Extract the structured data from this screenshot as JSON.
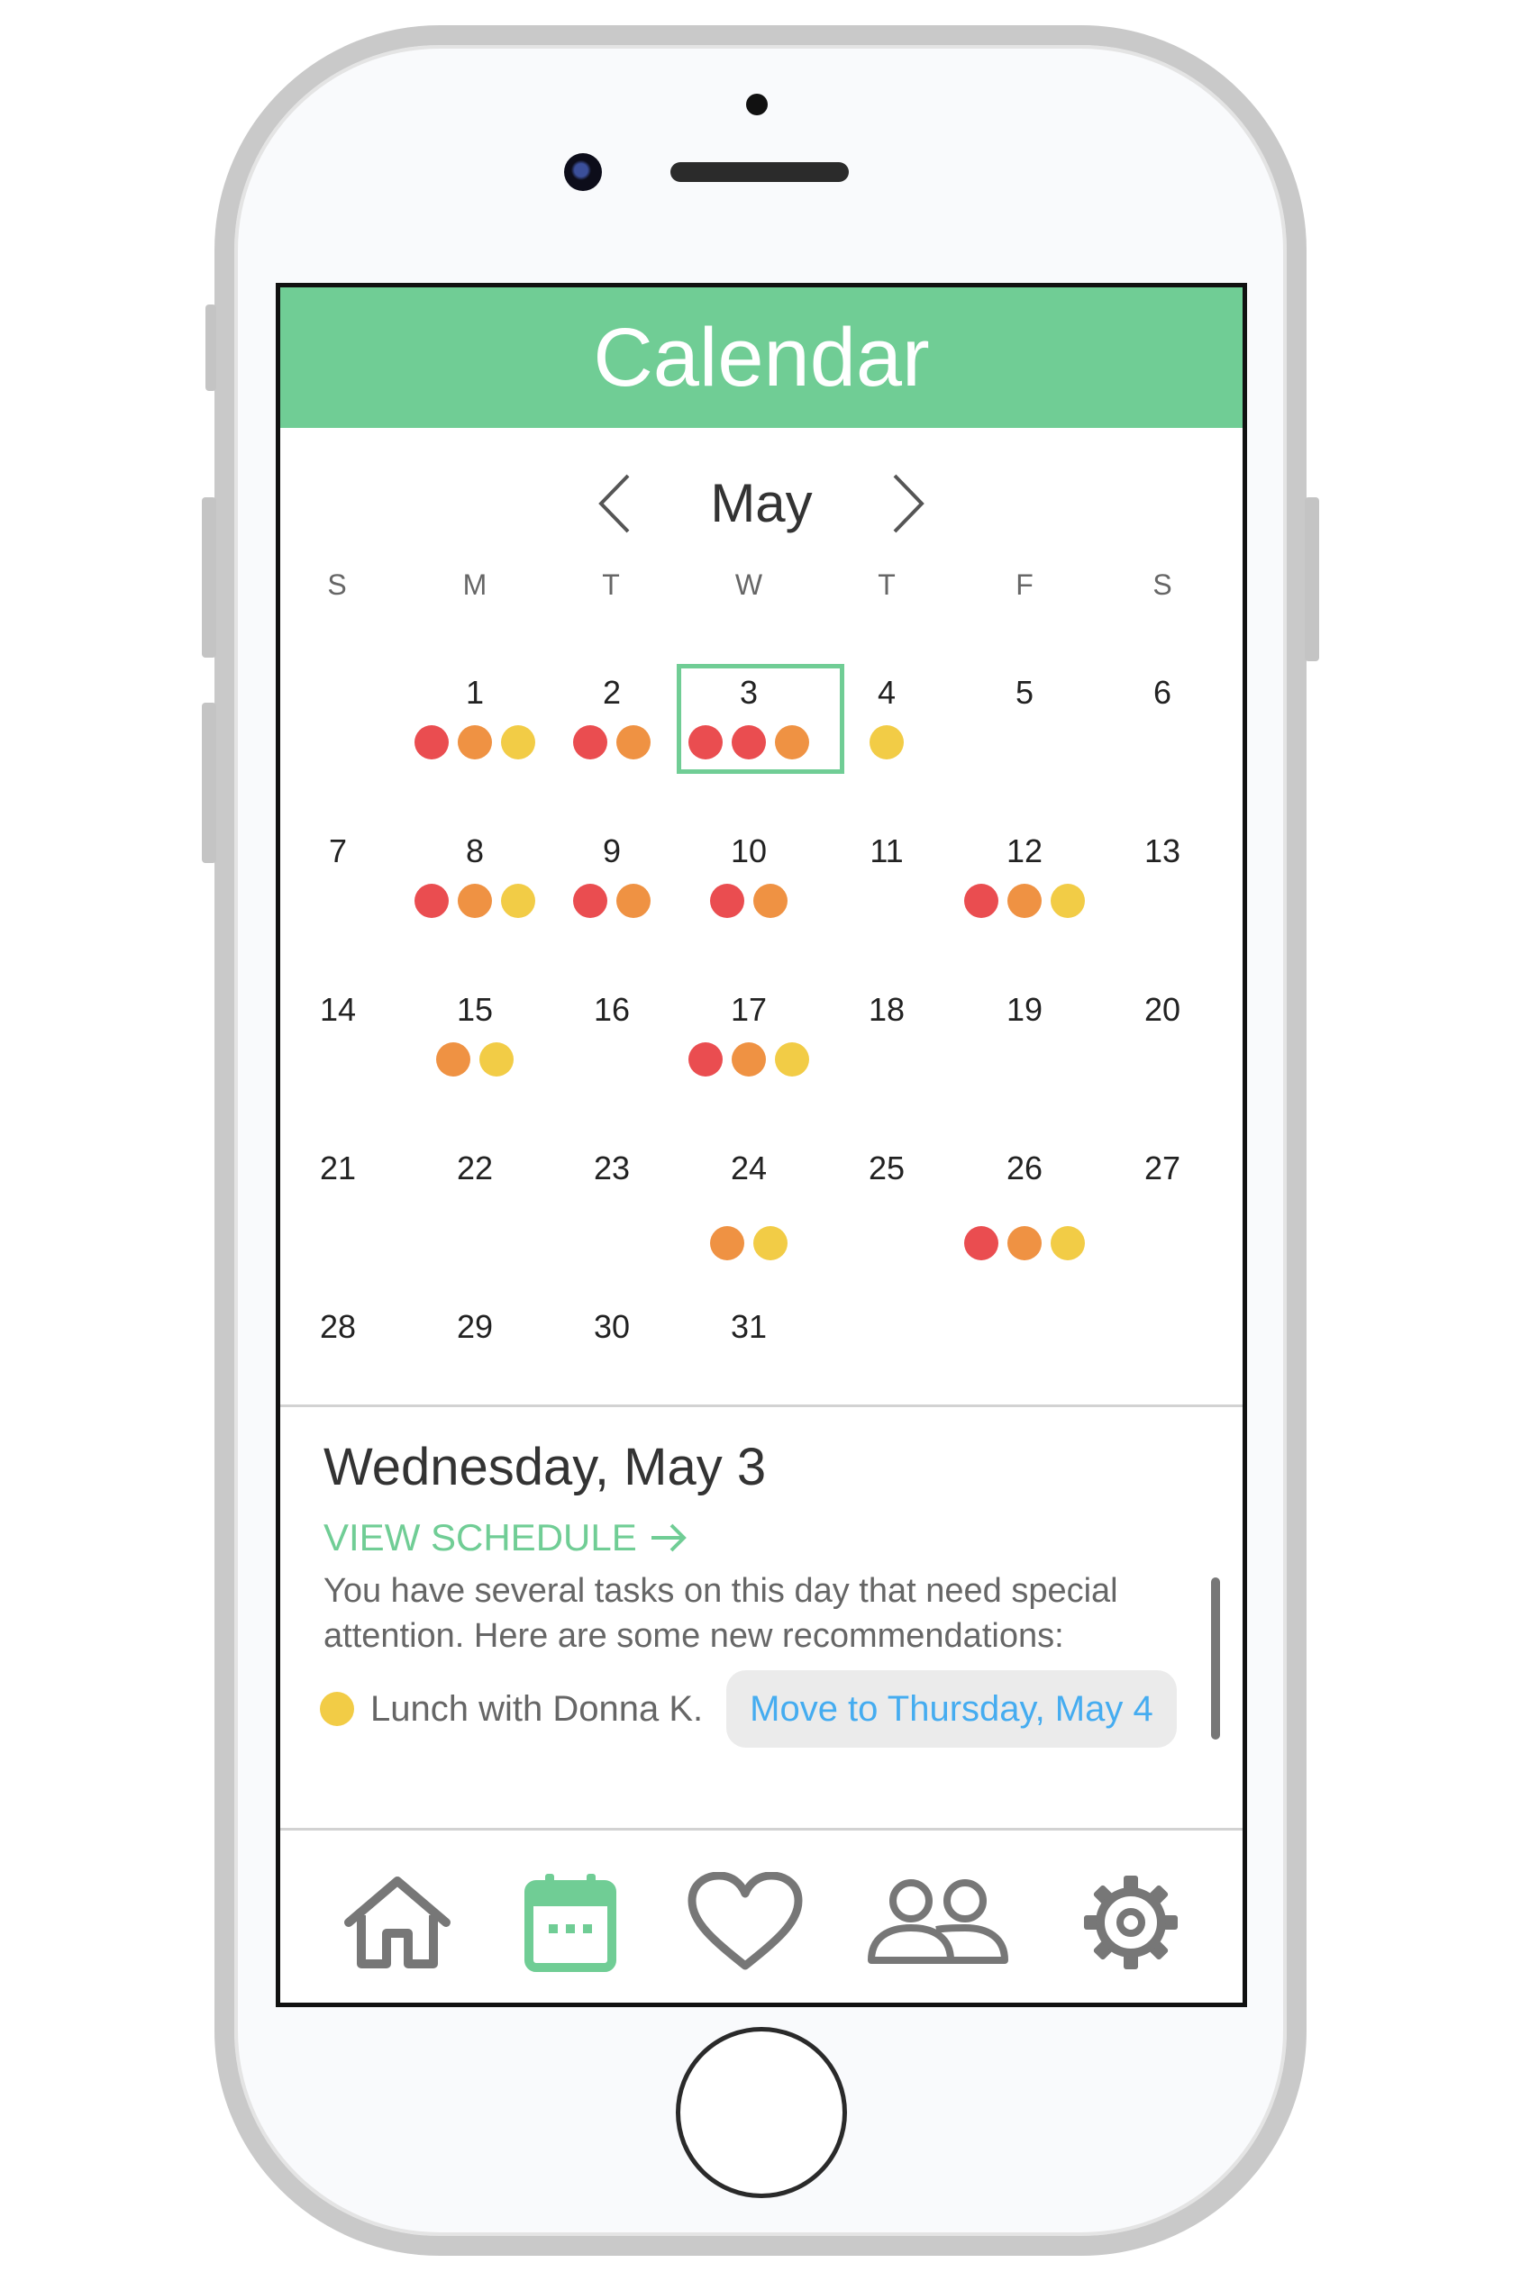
{
  "screen": {
    "title": "Calendar"
  },
  "calendar": {
    "month": "May",
    "weekdays": [
      "S",
      "M",
      "T",
      "W",
      "T",
      "F",
      "S"
    ],
    "days": [
      "1",
      "2",
      "3",
      "4",
      "5",
      "6",
      "7",
      "8",
      "9",
      "10",
      "11",
      "12",
      "13",
      "14",
      "15",
      "16",
      "17",
      "18",
      "19",
      "20",
      "21",
      "22",
      "23",
      "24",
      "25",
      "26",
      "27",
      "28",
      "29",
      "30",
      "31"
    ],
    "selected_day": "3"
  },
  "event_dots": {
    "1": [
      "red",
      "orange",
      "yellow"
    ],
    "2": [
      "red",
      "orange"
    ],
    "3": [
      "red",
      "red",
      "orange"
    ],
    "4": [
      "yellow"
    ],
    "8": [
      "red",
      "orange",
      "yellow"
    ],
    "9": [
      "red",
      "orange"
    ],
    "10": [
      "red",
      "orange"
    ],
    "12": [
      "red",
      "orange",
      "yellow"
    ],
    "15": [
      "orange",
      "yellow"
    ],
    "17": [
      "red",
      "orange",
      "yellow"
    ],
    "24": [
      "orange",
      "yellow"
    ],
    "26": [
      "red",
      "orange",
      "yellow"
    ]
  },
  "detail": {
    "date_heading": "Wednesday, May 3",
    "view_schedule_label": "VIEW SCHEDULE",
    "message_line1": "You have several tasks on this day that need special",
    "message_line2": "attention. Here are some new recommendations:",
    "task_label": "Lunch with Donna K.",
    "task_action_label": "Move to Thursday, May 4"
  },
  "bottom_nav": {
    "items": [
      "home-icon",
      "calendar-icon",
      "heart-icon",
      "people-icon",
      "settings-icon"
    ],
    "active": "calendar-icon"
  },
  "colors": {
    "accent": "#70cd95",
    "red": "#ea4d50",
    "orange": "#ef9243",
    "yellow": "#f2cc46",
    "link_blue": "#45acf0",
    "icon_gray": "#777777"
  }
}
